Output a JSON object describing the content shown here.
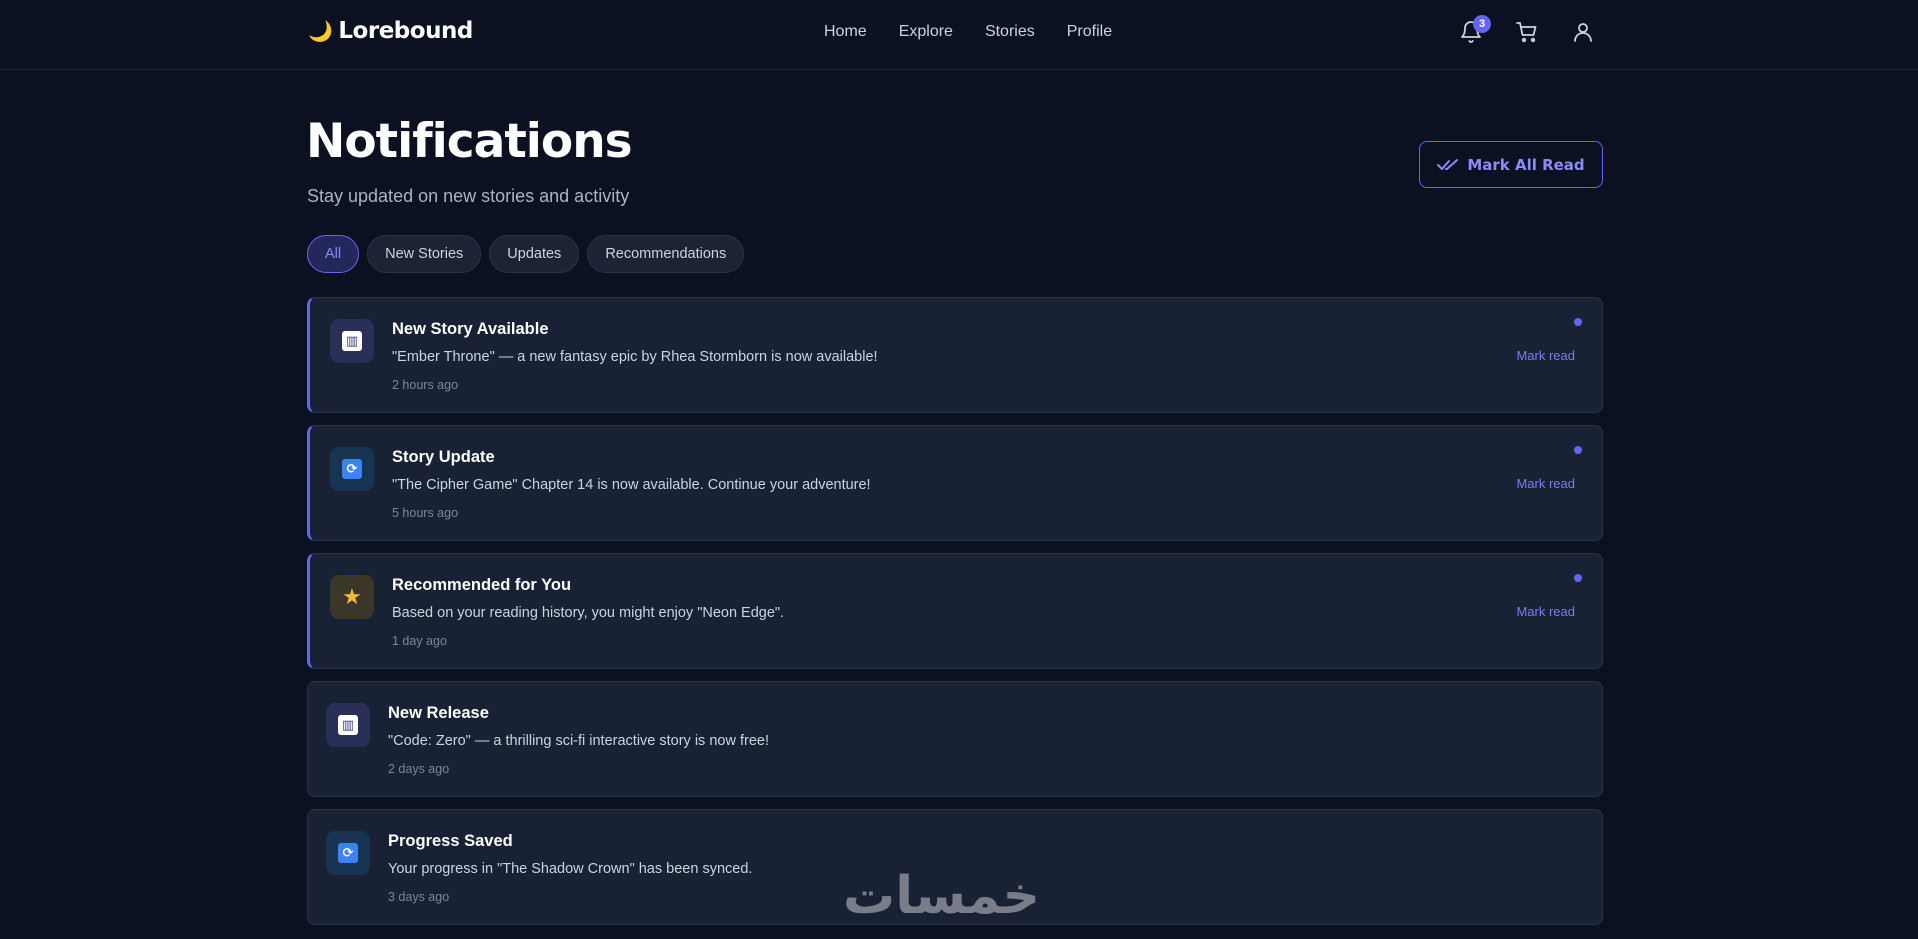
{
  "app": {
    "name": "Lorebound",
    "logo_icon": "moon-icon"
  },
  "nav": {
    "items": [
      "Home",
      "Explore",
      "Stories",
      "Profile"
    ]
  },
  "header_icons": {
    "notifications_count": "3",
    "cart": "cart-icon",
    "user": "user-icon"
  },
  "page": {
    "title": "Notifications",
    "subtitle": "Stay updated on new stories and activity",
    "mark_all_label": "Mark All Read"
  },
  "filters": [
    "All",
    "New Stories",
    "Updates",
    "Recommendations"
  ],
  "active_filter": "All",
  "notifications": [
    {
      "icon": "book-icon",
      "title": "New Story Available",
      "text": "\"Ember Throne\" — a new fantasy epic by Rhea Stormborn is now available!",
      "time": "2 hours ago",
      "unread": true,
      "action": "Mark read"
    },
    {
      "icon": "sync-icon",
      "title": "Story Update",
      "text": "\"The Cipher Game\" Chapter 14 is now available. Continue your adventure!",
      "time": "5 hours ago",
      "unread": true,
      "action": "Mark read"
    },
    {
      "icon": "star-icon",
      "title": "Recommended for You",
      "text": "Based on your reading history, you might enjoy \"Neon Edge\".",
      "time": "1 day ago",
      "unread": true,
      "action": "Mark read"
    },
    {
      "icon": "book-icon",
      "title": "New Release",
      "text": "\"Code: Zero\" — a thrilling sci-fi interactive story is now free!",
      "time": "2 days ago",
      "unread": false,
      "action": ""
    },
    {
      "icon": "sync-icon",
      "title": "Progress Saved",
      "text": "Your progress in \"The Shadow Crown\" has been synced.",
      "time": "3 days ago",
      "unread": false,
      "action": ""
    }
  ],
  "watermark": "خمسات",
  "colors": {
    "accent": "#6366f1",
    "background": "#0b1120",
    "card": "#192134"
  }
}
